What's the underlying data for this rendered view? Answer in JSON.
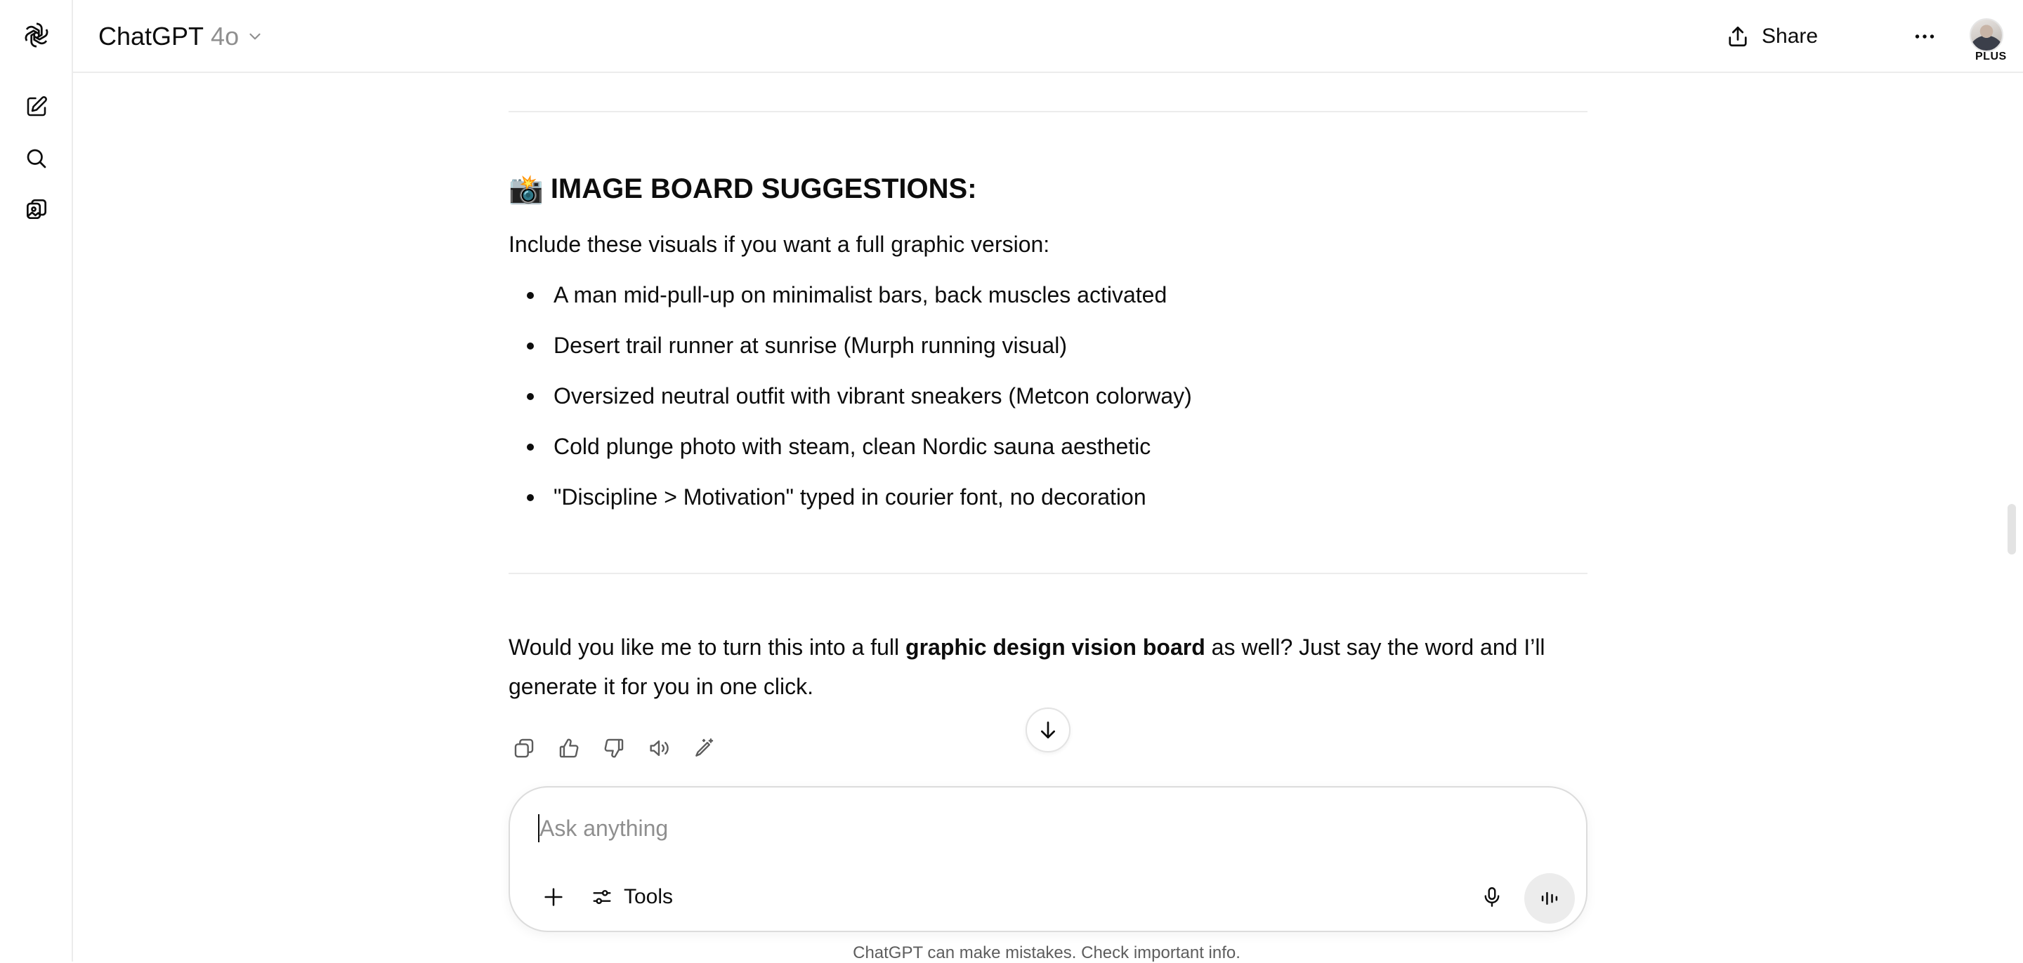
{
  "header": {
    "title": "ChatGPT",
    "model_version": "4o",
    "share_label": "Share",
    "plan_badge": "PLUS"
  },
  "sidebar": {
    "items": [
      {
        "name": "new-chat",
        "icon": "edit-icon"
      },
      {
        "name": "search",
        "icon": "search-icon"
      },
      {
        "name": "library",
        "icon": "library-icon"
      }
    ]
  },
  "message": {
    "section_emoji": "📸",
    "section_title": "IMAGE BOARD SUGGESTIONS:",
    "intro": "Include these visuals if you want a full graphic version:",
    "bullets": [
      "A man mid-pull-up on minimalist bars, back muscles activated",
      "Desert trail runner at sunrise (Murph running visual)",
      "Oversized neutral outfit with vibrant sneakers (Metcon colorway)",
      "Cold plunge photo with steam, clean Nordic sauna aesthetic",
      "\"Discipline > Motivation\" typed in courier font, no decoration"
    ],
    "closing_before": "Would you like me to turn this into a full ",
    "closing_bold": "graphic design vision board",
    "closing_after": " as well? Just say the word and I’ll generate it for you in one click."
  },
  "composer": {
    "placeholder": "Ask anything",
    "value": "",
    "tools_label": "Tools"
  },
  "footer": {
    "disclaimer": "ChatGPT can make mistakes. Check important info."
  }
}
